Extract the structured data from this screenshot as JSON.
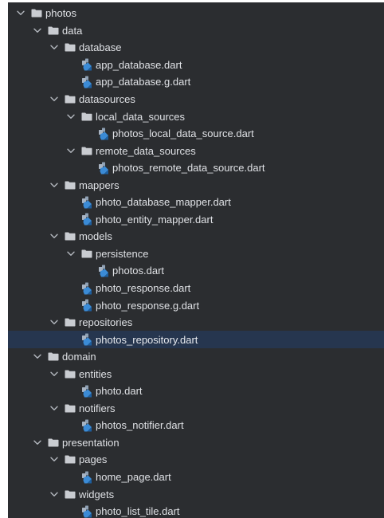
{
  "colors": {
    "panel_background": "#2b2d30",
    "text": "#dfe1e5",
    "selection": "#26364f",
    "folder_icon": "#c9ccd1",
    "chevron": "#b4b8bf",
    "dart_blue": "#3b8bd6"
  },
  "tree": [
    {
      "label": "photos",
      "type": "folder",
      "depth": 0
    },
    {
      "label": "data",
      "type": "folder",
      "depth": 1
    },
    {
      "label": "database",
      "type": "folder",
      "depth": 2
    },
    {
      "label": "app_database.dart",
      "type": "file",
      "depth": 3
    },
    {
      "label": "app_database.g.dart",
      "type": "file",
      "depth": 3
    },
    {
      "label": "datasources",
      "type": "folder",
      "depth": 2
    },
    {
      "label": "local_data_sources",
      "type": "folder",
      "depth": 3
    },
    {
      "label": "photos_local_data_source.dart",
      "type": "file",
      "depth": 4
    },
    {
      "label": "remote_data_sources",
      "type": "folder",
      "depth": 3
    },
    {
      "label": "photos_remote_data_source.dart",
      "type": "file",
      "depth": 4
    },
    {
      "label": "mappers",
      "type": "folder",
      "depth": 2
    },
    {
      "label": "photo_database_mapper.dart",
      "type": "file",
      "depth": 3
    },
    {
      "label": "photo_entity_mapper.dart",
      "type": "file",
      "depth": 3
    },
    {
      "label": "models",
      "type": "folder",
      "depth": 2
    },
    {
      "label": "persistence",
      "type": "folder",
      "depth": 3
    },
    {
      "label": "photos.dart",
      "type": "file",
      "depth": 4
    },
    {
      "label": "photo_response.dart",
      "type": "file",
      "depth": 3
    },
    {
      "label": "photo_response.g.dart",
      "type": "file",
      "depth": 3
    },
    {
      "label": "repositories",
      "type": "folder",
      "depth": 2
    },
    {
      "label": "photos_repository.dart",
      "type": "file",
      "depth": 3,
      "selected": true
    },
    {
      "label": "domain",
      "type": "folder",
      "depth": 1
    },
    {
      "label": "entities",
      "type": "folder",
      "depth": 2
    },
    {
      "label": "photo.dart",
      "type": "file",
      "depth": 3
    },
    {
      "label": "notifiers",
      "type": "folder",
      "depth": 2
    },
    {
      "label": "photos_notifier.dart",
      "type": "file",
      "depth": 3
    },
    {
      "label": "presentation",
      "type": "folder",
      "depth": 1
    },
    {
      "label": "pages",
      "type": "folder",
      "depth": 2
    },
    {
      "label": "home_page.dart",
      "type": "file",
      "depth": 3
    },
    {
      "label": "widgets",
      "type": "folder",
      "depth": 2
    },
    {
      "label": "photo_list_tile.dart",
      "type": "file",
      "depth": 3
    }
  ]
}
